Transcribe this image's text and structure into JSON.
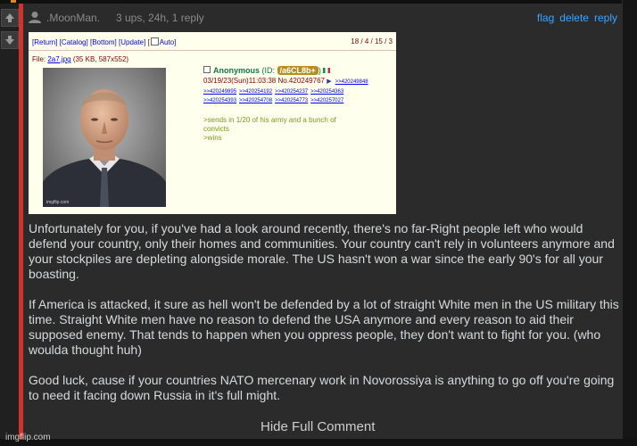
{
  "comment": {
    "username": ".MoonMan.",
    "meta": "3 ups, 24h, 1 reply",
    "actions": {
      "flag": "flag",
      "delete": "delete",
      "reply": "reply"
    },
    "body": [
      "Unfortunately for you, if you've had a look around recently, there's no far-Right people left who would defend your country, only their homes and communities. Your country can't rely in volunteers anymore and your stockpiles are depleting alongside morale. The US hasn't won a war since the early 90's for all your boasting.",
      "If America is attacked, it sure as hell won't be defended by a lot of straight White men in the US military this time. Straight White men have no reason to defend the USA anymore and every reason to aid their supposed enemy. That tends to happen when you oppress people, they don't want to fight for you. (who woulda thought huh)",
      "Good luck, cause if your countries NATO mercenary work in Novorossiya is anything to go off you're going to need it facing down Russia in it's full might."
    ],
    "hide_label": "Hide Full Comment"
  },
  "embedded": {
    "nav": [
      "[Return]",
      "[Catalog]",
      "[Bottom]",
      "[Update]",
      "[",
      "Auto]"
    ],
    "stats": "18 / 4 / 15 / 3",
    "file_prefix": "File: ",
    "file_link": "2a7.jpg",
    "file_info": " (35 KB, 587x552)",
    "poster": "Anonymous",
    "id_prefix": "(ID: ",
    "id_value": "/a6CL8b+",
    "id_suffix": ")",
    "date_no": "03/19/23(Sun)11:03:38 No.420249767",
    "reply_link": ">>420249848",
    "replies": [
      ">>420249895",
      ">>420254192",
      ">>420254237",
      ">>420254363",
      ">>420254393",
      ">>420254708",
      ">>420254773",
      ">>420257027"
    ],
    "greentext": [
      ">sends in 1/20 of his army and a bunch of",
      "convicts",
      ">wins"
    ],
    "image_watermark": "imgflip.com"
  },
  "watermark": "imgflip.com",
  "colors": {
    "accent": "#d0322c",
    "link": "#3ea6ff",
    "greentext": "#789922"
  }
}
